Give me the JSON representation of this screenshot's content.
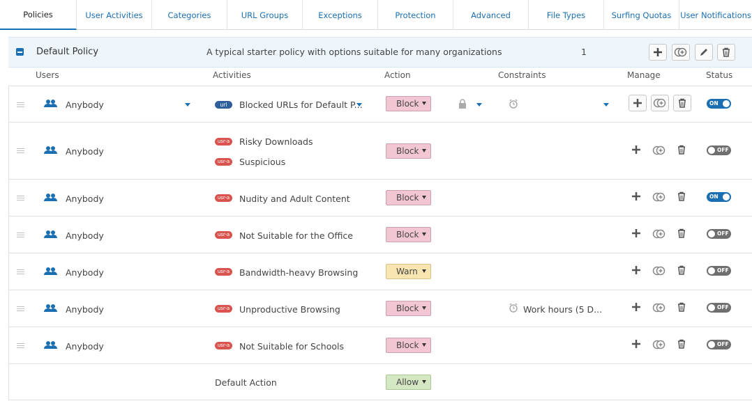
{
  "tabs": [
    "Policies",
    "User Activities",
    "Categories",
    "URL Groups",
    "Exceptions",
    "Protection",
    "Advanced",
    "File Types",
    "Surfing Quotas",
    "User Notifications"
  ],
  "active_tab": "Policies",
  "policy": {
    "name": "Default Policy",
    "description": "A typical starter policy with options suitable for many organizations",
    "count": "1"
  },
  "columns": {
    "users": "Users",
    "activities": "Activities",
    "action": "Action",
    "constraints": "Constraints",
    "manage": "Manage",
    "status": "Status"
  },
  "rules": [
    {
      "user": "Anybody",
      "activities": [
        {
          "badge": "url",
          "label": "Blocked URLs for Default P..."
        }
      ],
      "action": "Block",
      "constraint": "",
      "status": "ON"
    },
    {
      "user": "Anybody",
      "activities": [
        {
          "badge": "usr-a",
          "label": "Risky Downloads"
        },
        {
          "badge": "usr-a",
          "label": "Suspicious"
        }
      ],
      "action": "Block",
      "constraint": "",
      "status": "OFF"
    },
    {
      "user": "Anybody",
      "activities": [
        {
          "badge": "usr-a",
          "label": "Nudity and Adult Content"
        }
      ],
      "action": "Block",
      "constraint": "",
      "status": "ON"
    },
    {
      "user": "Anybody",
      "activities": [
        {
          "badge": "usr-a",
          "label": "Not Suitable for the Office"
        }
      ],
      "action": "Block",
      "constraint": "",
      "status": "OFF"
    },
    {
      "user": "Anybody",
      "activities": [
        {
          "badge": "usr-a",
          "label": "Bandwidth-heavy Browsing"
        }
      ],
      "action": "Warn",
      "constraint": "",
      "status": "OFF"
    },
    {
      "user": "Anybody",
      "activities": [
        {
          "badge": "usr-a",
          "label": "Unproductive Browsing"
        }
      ],
      "action": "Block",
      "constraint": "Work hours (5 D...",
      "status": "OFF"
    },
    {
      "user": "Anybody",
      "activities": [
        {
          "badge": "usr-a",
          "label": "Not Suitable for Schools"
        }
      ],
      "action": "Block",
      "constraint": "",
      "status": "OFF"
    }
  ],
  "default_action": {
    "label": "Default Action",
    "action": "Allow"
  },
  "colors": {
    "accent": "#1a6fb3",
    "block": "#f3c6d3",
    "warn": "#f8e5b0",
    "allow": "#d5e8c4",
    "badge": "#d9534f"
  }
}
